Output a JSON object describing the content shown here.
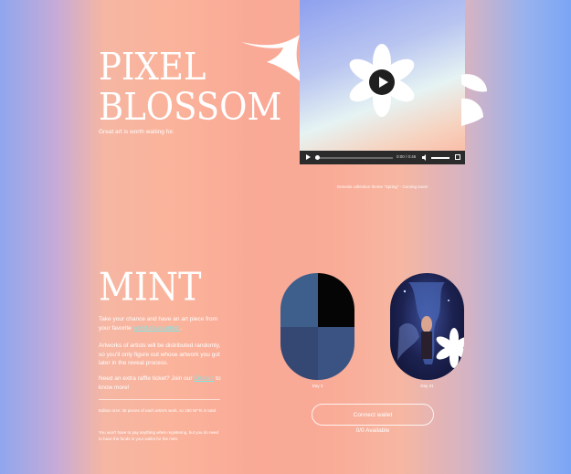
{
  "hero": {
    "title_line1": "PIXEL",
    "title_line2": "BLOSSOM",
    "tagline": "Great art is worth waiting for."
  },
  "video": {
    "time": "0:00 / 0:45",
    "caption": "Genesis collection theme \"Spring\" - Coming soon!"
  },
  "mint": {
    "title": "MINT",
    "p1_before": "Take your chance and have an art piece from your favorite ",
    "p1_link": "world-class artists",
    "p1_after": ".",
    "p2": "Artworks of artists will be distributed randomly, so you'll only figure out whose artwork you got later in the reveal process.",
    "p3_before": "Need an extra raffle ticket? Join our ",
    "p3_link": "Discord",
    "p3_after": " to know more!",
    "note1": "Edition size: 36 pieces of each artist's work, so 180 NFTs in total.",
    "note2": "You won't have to pay anything when registering, but you do need to have the funds in your wallet for the mint."
  },
  "cards": {
    "day3_label": "Day 3",
    "day31_label": "Day 31",
    "day3_colors": [
      "#3e5f8c",
      "#050505",
      "#354773",
      "#3a5383"
    ]
  },
  "wallet": {
    "connect_label": "Connect wallet",
    "available": "0/0 Available"
  }
}
